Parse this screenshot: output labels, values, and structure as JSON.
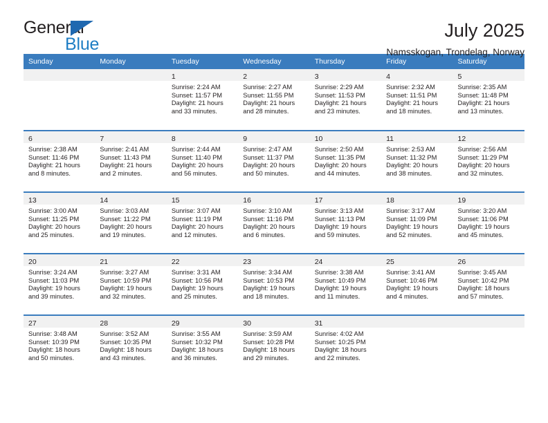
{
  "brand": {
    "name_part1": "General",
    "name_part2": "Blue",
    "triangle_icon": "blue-triangle-icon",
    "colors": {
      "general_text": "#231f20",
      "blue_text": "#1f7ec4",
      "triangle": "#1f68b0"
    }
  },
  "header": {
    "title": "July 2025",
    "subtitle": "Namsskogan, Trondelag, Norway"
  },
  "calendar": {
    "header_bg": "#3a7cbe",
    "daynum_band_bg": "#f1f1f1",
    "weekday_headers": [
      "Sunday",
      "Monday",
      "Tuesday",
      "Wednesday",
      "Thursday",
      "Friday",
      "Saturday"
    ],
    "weeks": [
      [
        {
          "day": "",
          "sunrise": "",
          "sunset": "",
          "daylight": ""
        },
        {
          "day": "",
          "sunrise": "",
          "sunset": "",
          "daylight": ""
        },
        {
          "day": "1",
          "sunrise": "Sunrise: 2:24 AM",
          "sunset": "Sunset: 11:57 PM",
          "daylight": "Daylight: 21 hours and 33 minutes."
        },
        {
          "day": "2",
          "sunrise": "Sunrise: 2:27 AM",
          "sunset": "Sunset: 11:55 PM",
          "daylight": "Daylight: 21 hours and 28 minutes."
        },
        {
          "day": "3",
          "sunrise": "Sunrise: 2:29 AM",
          "sunset": "Sunset: 11:53 PM",
          "daylight": "Daylight: 21 hours and 23 minutes."
        },
        {
          "day": "4",
          "sunrise": "Sunrise: 2:32 AM",
          "sunset": "Sunset: 11:51 PM",
          "daylight": "Daylight: 21 hours and 18 minutes."
        },
        {
          "day": "5",
          "sunrise": "Sunrise: 2:35 AM",
          "sunset": "Sunset: 11:48 PM",
          "daylight": "Daylight: 21 hours and 13 minutes."
        }
      ],
      [
        {
          "day": "6",
          "sunrise": "Sunrise: 2:38 AM",
          "sunset": "Sunset: 11:46 PM",
          "daylight": "Daylight: 21 hours and 8 minutes."
        },
        {
          "day": "7",
          "sunrise": "Sunrise: 2:41 AM",
          "sunset": "Sunset: 11:43 PM",
          "daylight": "Daylight: 21 hours and 2 minutes."
        },
        {
          "day": "8",
          "sunrise": "Sunrise: 2:44 AM",
          "sunset": "Sunset: 11:40 PM",
          "daylight": "Daylight: 20 hours and 56 minutes."
        },
        {
          "day": "9",
          "sunrise": "Sunrise: 2:47 AM",
          "sunset": "Sunset: 11:37 PM",
          "daylight": "Daylight: 20 hours and 50 minutes."
        },
        {
          "day": "10",
          "sunrise": "Sunrise: 2:50 AM",
          "sunset": "Sunset: 11:35 PM",
          "daylight": "Daylight: 20 hours and 44 minutes."
        },
        {
          "day": "11",
          "sunrise": "Sunrise: 2:53 AM",
          "sunset": "Sunset: 11:32 PM",
          "daylight": "Daylight: 20 hours and 38 minutes."
        },
        {
          "day": "12",
          "sunrise": "Sunrise: 2:56 AM",
          "sunset": "Sunset: 11:29 PM",
          "daylight": "Daylight: 20 hours and 32 minutes."
        }
      ],
      [
        {
          "day": "13",
          "sunrise": "Sunrise: 3:00 AM",
          "sunset": "Sunset: 11:25 PM",
          "daylight": "Daylight: 20 hours and 25 minutes."
        },
        {
          "day": "14",
          "sunrise": "Sunrise: 3:03 AM",
          "sunset": "Sunset: 11:22 PM",
          "daylight": "Daylight: 20 hours and 19 minutes."
        },
        {
          "day": "15",
          "sunrise": "Sunrise: 3:07 AM",
          "sunset": "Sunset: 11:19 PM",
          "daylight": "Daylight: 20 hours and 12 minutes."
        },
        {
          "day": "16",
          "sunrise": "Sunrise: 3:10 AM",
          "sunset": "Sunset: 11:16 PM",
          "daylight": "Daylight: 20 hours and 6 minutes."
        },
        {
          "day": "17",
          "sunrise": "Sunrise: 3:13 AM",
          "sunset": "Sunset: 11:13 PM",
          "daylight": "Daylight: 19 hours and 59 minutes."
        },
        {
          "day": "18",
          "sunrise": "Sunrise: 3:17 AM",
          "sunset": "Sunset: 11:09 PM",
          "daylight": "Daylight: 19 hours and 52 minutes."
        },
        {
          "day": "19",
          "sunrise": "Sunrise: 3:20 AM",
          "sunset": "Sunset: 11:06 PM",
          "daylight": "Daylight: 19 hours and 45 minutes."
        }
      ],
      [
        {
          "day": "20",
          "sunrise": "Sunrise: 3:24 AM",
          "sunset": "Sunset: 11:03 PM",
          "daylight": "Daylight: 19 hours and 39 minutes."
        },
        {
          "day": "21",
          "sunrise": "Sunrise: 3:27 AM",
          "sunset": "Sunset: 10:59 PM",
          "daylight": "Daylight: 19 hours and 32 minutes."
        },
        {
          "day": "22",
          "sunrise": "Sunrise: 3:31 AM",
          "sunset": "Sunset: 10:56 PM",
          "daylight": "Daylight: 19 hours and 25 minutes."
        },
        {
          "day": "23",
          "sunrise": "Sunrise: 3:34 AM",
          "sunset": "Sunset: 10:53 PM",
          "daylight": "Daylight: 19 hours and 18 minutes."
        },
        {
          "day": "24",
          "sunrise": "Sunrise: 3:38 AM",
          "sunset": "Sunset: 10:49 PM",
          "daylight": "Daylight: 19 hours and 11 minutes."
        },
        {
          "day": "25",
          "sunrise": "Sunrise: 3:41 AM",
          "sunset": "Sunset: 10:46 PM",
          "daylight": "Daylight: 19 hours and 4 minutes."
        },
        {
          "day": "26",
          "sunrise": "Sunrise: 3:45 AM",
          "sunset": "Sunset: 10:42 PM",
          "daylight": "Daylight: 18 hours and 57 minutes."
        }
      ],
      [
        {
          "day": "27",
          "sunrise": "Sunrise: 3:48 AM",
          "sunset": "Sunset: 10:39 PM",
          "daylight": "Daylight: 18 hours and 50 minutes."
        },
        {
          "day": "28",
          "sunrise": "Sunrise: 3:52 AM",
          "sunset": "Sunset: 10:35 PM",
          "daylight": "Daylight: 18 hours and 43 minutes."
        },
        {
          "day": "29",
          "sunrise": "Sunrise: 3:55 AM",
          "sunset": "Sunset: 10:32 PM",
          "daylight": "Daylight: 18 hours and 36 minutes."
        },
        {
          "day": "30",
          "sunrise": "Sunrise: 3:59 AM",
          "sunset": "Sunset: 10:28 PM",
          "daylight": "Daylight: 18 hours and 29 minutes."
        },
        {
          "day": "31",
          "sunrise": "Sunrise: 4:02 AM",
          "sunset": "Sunset: 10:25 PM",
          "daylight": "Daylight: 18 hours and 22 minutes."
        },
        {
          "day": "",
          "sunrise": "",
          "sunset": "",
          "daylight": ""
        },
        {
          "day": "",
          "sunrise": "",
          "sunset": "",
          "daylight": ""
        }
      ]
    ]
  }
}
